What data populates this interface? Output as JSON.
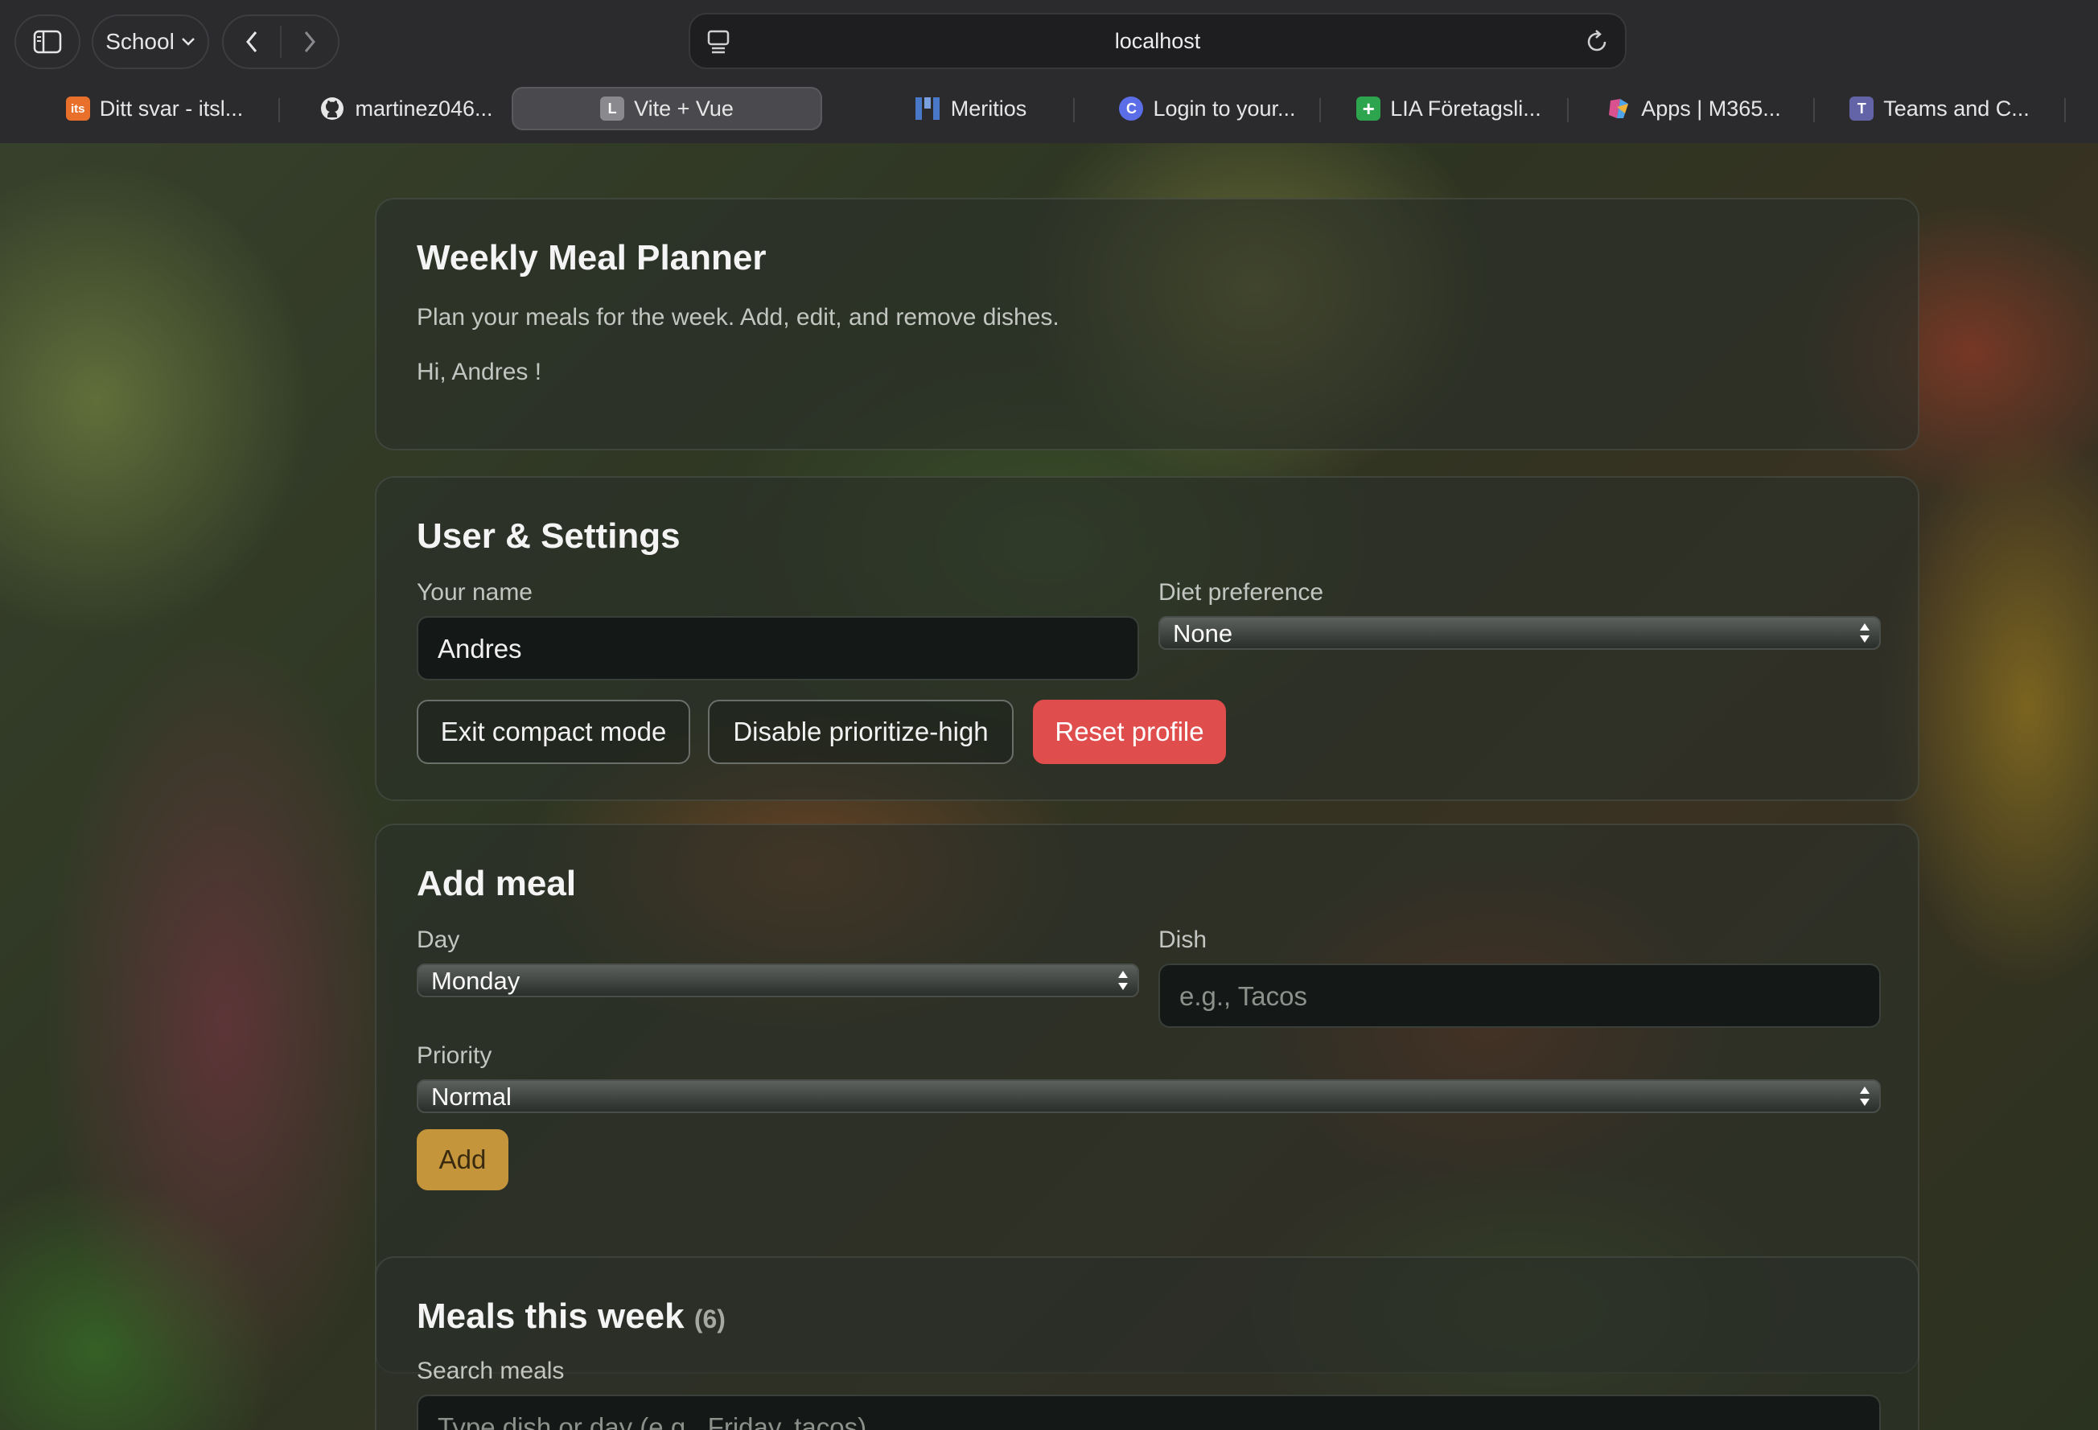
{
  "browser": {
    "profile": "School",
    "url": "localhost",
    "tabs": [
      {
        "label": "Ditt svar - itsl...",
        "icon": "itslearning-icon",
        "color": "#e8702a",
        "glyph": "its"
      },
      {
        "label": "martinez046...",
        "icon": "github-icon",
        "color": "#e6e6e6",
        "glyph": ""
      },
      {
        "label": "Vite + Vue",
        "icon": "letter-l-icon",
        "color": "#8a8a8e",
        "glyph": "L",
        "active": true
      },
      {
        "label": "Meritios",
        "icon": "meritios-icon",
        "color": "#4a78c8",
        "glyph": ""
      },
      {
        "label": "Login to your...",
        "icon": "canva-icon",
        "color": "#5b6ee8",
        "glyph": "C"
      },
      {
        "label": "LIA Företagsli...",
        "icon": "sheets-icon",
        "color": "#2da44e",
        "glyph": "+"
      },
      {
        "label": "Apps | M365...",
        "icon": "m365-icon",
        "color": "#d9518f",
        "glyph": ""
      },
      {
        "label": "Teams and C...",
        "icon": "teams-icon",
        "color": "#6264a7",
        "glyph": "T"
      }
    ]
  },
  "header": {
    "title": "Weekly Meal Planner",
    "subtitle": "Plan your meals for the week. Add, edit, and remove dishes.",
    "greeting": "Hi, Andres !"
  },
  "settings": {
    "title": "User & Settings",
    "name_label": "Your name",
    "name_value": "Andres",
    "diet_label": "Diet preference",
    "diet_value": "None",
    "compact_button": "Exit compact mode",
    "prioritize_button": "Disable prioritize-high",
    "reset_button": "Reset profile"
  },
  "add_meal": {
    "title": "Add meal",
    "day_label": "Day",
    "day_value": "Monday",
    "dish_label": "Dish",
    "dish_placeholder": "e.g., Tacos",
    "priority_label": "Priority",
    "priority_value": "Normal",
    "add_button": "Add"
  },
  "meals": {
    "title": "Meals this week",
    "count": "(6)",
    "search_label": "Search meals",
    "search_placeholder": "Type dish or day (e.g., Friday, tacos)"
  },
  "colors": {
    "danger": "#e04d4d",
    "accent": "#c5953b"
  }
}
